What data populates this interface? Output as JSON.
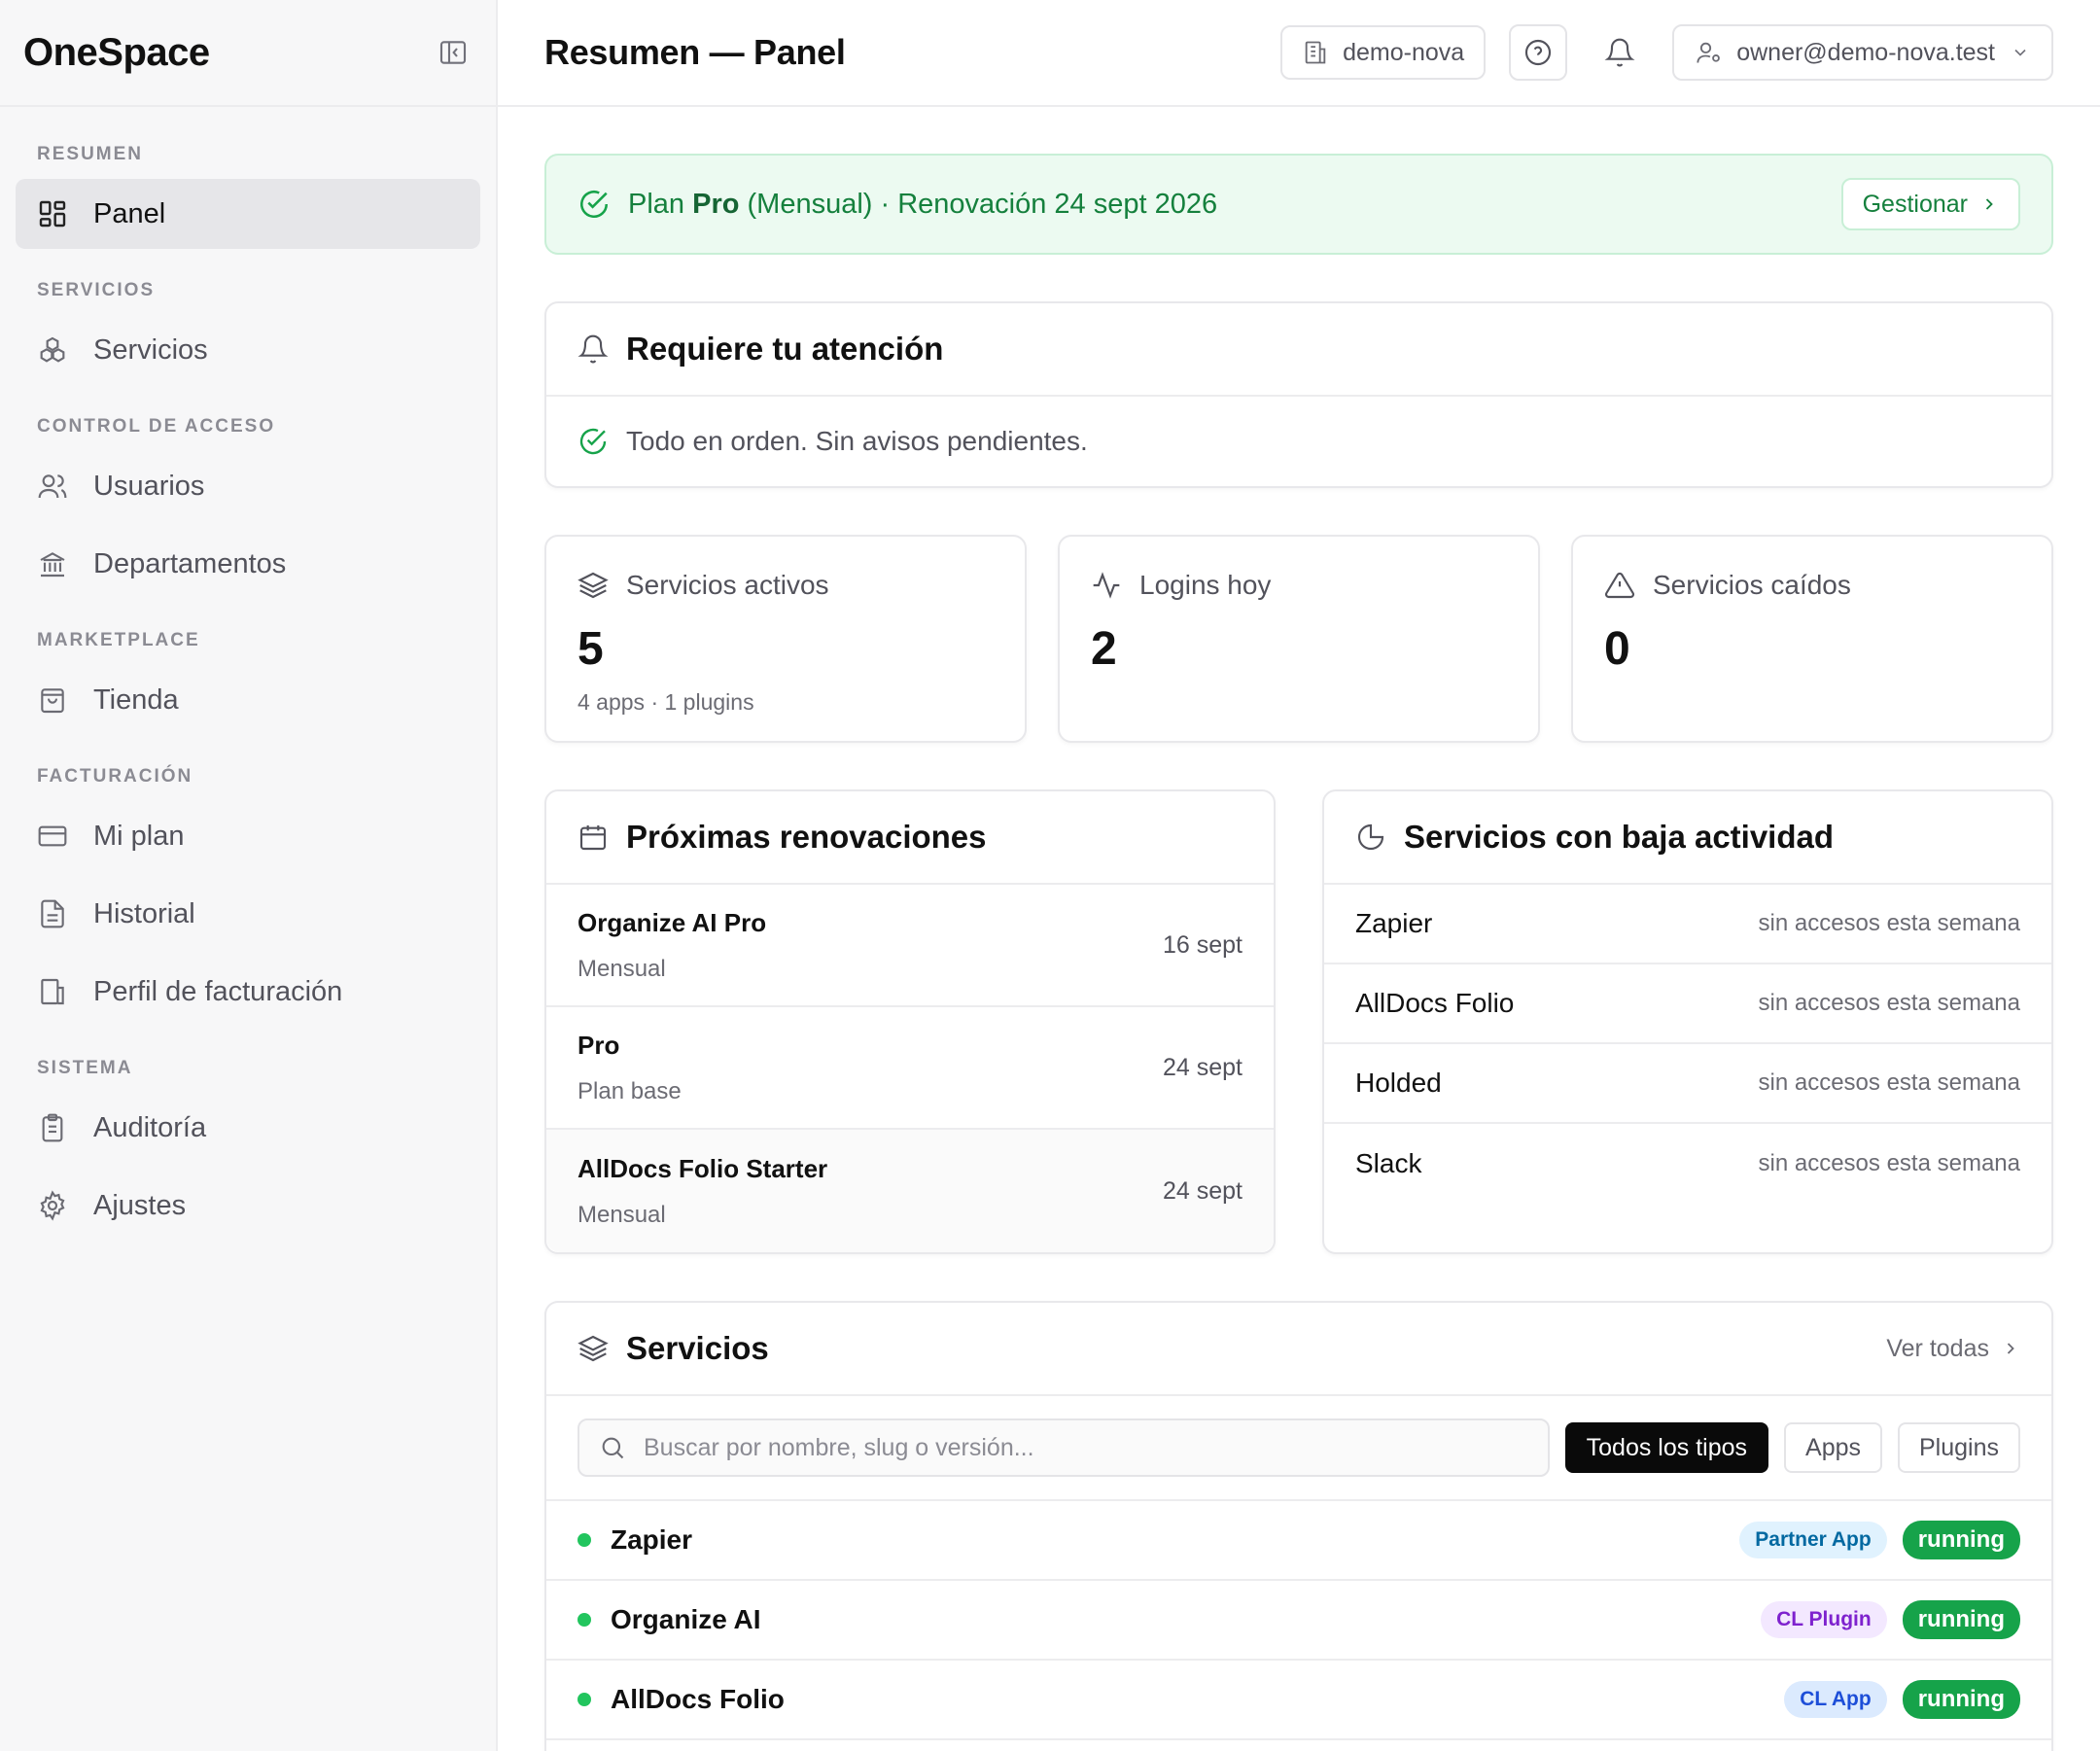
{
  "sidebar": {
    "brand": "OneSpace",
    "sections": [
      {
        "title": "RESUMEN",
        "items": [
          {
            "label": "Panel",
            "icon": "dashboard-icon",
            "active": true
          }
        ]
      },
      {
        "title": "SERVICIOS",
        "items": [
          {
            "label": "Servicios",
            "icon": "boxes-icon"
          }
        ]
      },
      {
        "title": "CONTROL DE ACCESO",
        "items": [
          {
            "label": "Usuarios",
            "icon": "users-icon"
          },
          {
            "label": "Departamentos",
            "icon": "landmark-icon"
          }
        ]
      },
      {
        "title": "MARKETPLACE",
        "items": [
          {
            "label": "Tienda",
            "icon": "shopping-bag-icon"
          }
        ]
      },
      {
        "title": "FACTURACIÓN",
        "items": [
          {
            "label": "Mi plan",
            "icon": "credit-card-icon"
          },
          {
            "label": "Historial",
            "icon": "file-text-icon"
          },
          {
            "label": "Perfil de facturación",
            "icon": "building-icon"
          }
        ]
      },
      {
        "title": "SISTEMA",
        "items": [
          {
            "label": "Auditoría",
            "icon": "clipboard-icon"
          },
          {
            "label": "Ajustes",
            "icon": "gear-icon"
          }
        ]
      }
    ]
  },
  "header": {
    "title": "Resumen — Panel",
    "tenant": "demo-nova",
    "user": "owner@demo-nova.test"
  },
  "plan_banner": {
    "prefix": "Plan ",
    "plan": "Pro",
    "suffix": " (Mensual) · Renovación 24 sept 2026",
    "manage_label": "Gestionar"
  },
  "attention": {
    "title": "Requiere tu atención",
    "message": "Todo en orden. Sin avisos pendientes."
  },
  "stats": [
    {
      "label": "Servicios activos",
      "value": "5",
      "sub": "4 apps · 1 plugins",
      "icon": "layers-icon"
    },
    {
      "label": "Logins hoy",
      "value": "2",
      "sub": "",
      "icon": "activity-icon"
    },
    {
      "label": "Servicios caídos",
      "value": "0",
      "sub": "",
      "icon": "alert-triangle-icon"
    }
  ],
  "renewals": {
    "title": "Próximas renovaciones",
    "rows": [
      {
        "name": "Organize AI Pro",
        "sub": "Mensual",
        "date": "16 sept"
      },
      {
        "name": "Pro",
        "sub": "Plan base",
        "date": "24 sept"
      },
      {
        "name": "AllDocs Folio Starter",
        "sub": "Mensual",
        "date": "24 sept"
      }
    ]
  },
  "low_activity": {
    "title": "Servicios con baja actividad",
    "rows": [
      {
        "name": "Zapier",
        "status": "sin accesos esta semana"
      },
      {
        "name": "AllDocs Folio",
        "status": "sin accesos esta semana"
      },
      {
        "name": "Holded",
        "status": "sin accesos esta semana"
      },
      {
        "name": "Slack",
        "status": "sin accesos esta semana"
      }
    ]
  },
  "services": {
    "title": "Servicios",
    "see_all": "Ver todas",
    "search_placeholder": "Buscar por nombre, slug o versión...",
    "filters": [
      "Todos los tipos",
      "Apps",
      "Plugins"
    ],
    "rows": [
      {
        "name": "Zapier",
        "type": "Partner App",
        "status": "running"
      },
      {
        "name": "Organize AI",
        "type": "CL Plugin",
        "status": "running"
      },
      {
        "name": "AllDocs Folio",
        "type": "CL App",
        "status": "running"
      }
    ]
  },
  "colors": {
    "accent_green": "#16a34a",
    "banner_bg": "#ecfaf1",
    "active_filter": "#0a0a0a"
  }
}
